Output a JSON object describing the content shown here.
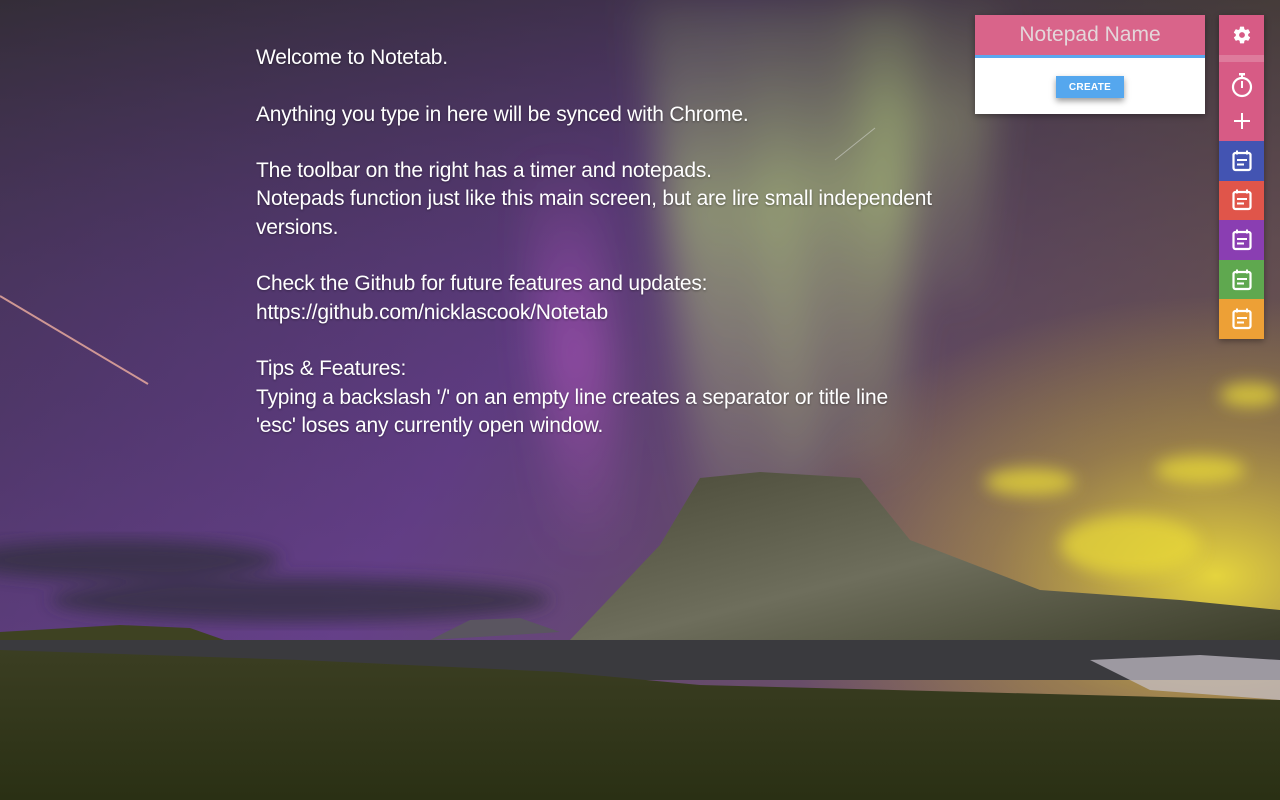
{
  "editor": {
    "content": "Welcome to Notetab.\n\nAnything you type in here will be synced with Chrome.\n\nThe toolbar on the right has a timer and notepads.\nNotepads function just like this main screen, but are lire small independent versions.\n\nCheck the Github for future features and updates:\nhttps://github.com/nicklascook/Notetab\n\nTips & Features:\nTyping a backslash '/' on an empty line creates a separator or title line\n'esc' loses any currently open window."
  },
  "new_notepad": {
    "name_placeholder": "Notepad Name",
    "create_label": "CREATE",
    "header_color": "#d9648a",
    "underline_color": "#5aa8ef",
    "button_color": "#55a7ee"
  },
  "toolbar": {
    "accent_color": "#d75b85",
    "settings_icon": "gear-icon",
    "timer_icon": "stopwatch-icon",
    "add_icon": "plus-icon",
    "notepads": [
      {
        "color": "#4354b2",
        "icon": "notepad-icon"
      },
      {
        "color": "#e0554a",
        "icon": "notepad-icon"
      },
      {
        "color": "#8a3eb2",
        "icon": "notepad-icon"
      },
      {
        "color": "#5fa84f",
        "icon": "notepad-icon"
      },
      {
        "color": "#eda036",
        "icon": "notepad-icon"
      }
    ]
  }
}
